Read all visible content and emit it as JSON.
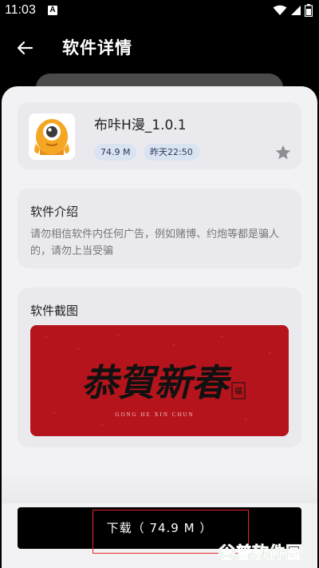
{
  "status_bar": {
    "time": "11:03",
    "notif_letter": "A"
  },
  "header": {
    "title": "软件详情",
    "back_icon": "arrow-left-icon"
  },
  "app": {
    "name": "布咔H漫_1.0.1",
    "size": "74.9 M",
    "date": "昨天22:50",
    "favorite_icon": "star-icon"
  },
  "intro": {
    "title": "软件介绍",
    "text": "请勿相信软件内任何广告，例如赌博、约炮等都是骗人的，请勿上当受骗"
  },
  "screenshots": {
    "title": "软件截图",
    "image": {
      "calligraphy": "恭賀新春",
      "pinyin": "GONG HE XIN CHUN",
      "seal": "福"
    }
  },
  "download": {
    "label": "下载（ 74.9 M ）"
  },
  "watermark": {
    "text": "谷普软件园"
  },
  "colors": {
    "accent_red": "#b6141c",
    "chip_bg": "#d9e3f2",
    "highlight": "#e8262a"
  }
}
